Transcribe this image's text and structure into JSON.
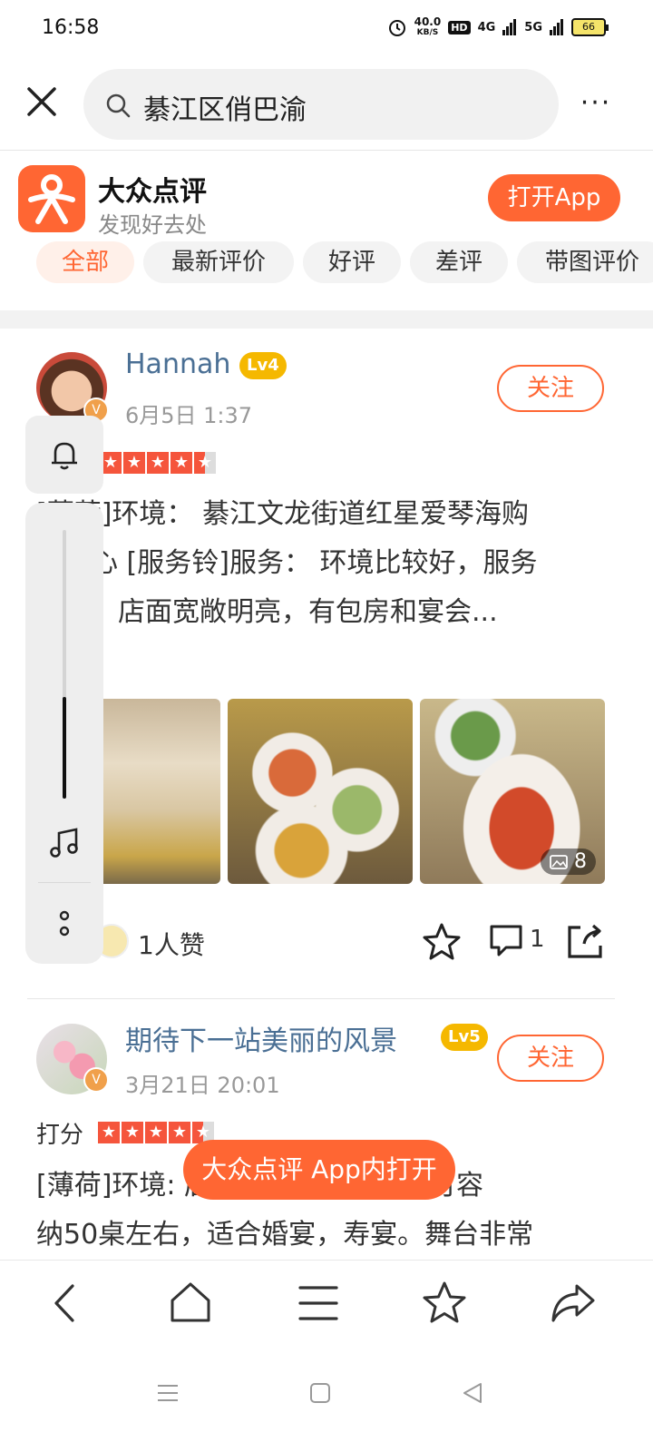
{
  "status_bar": {
    "time": "16:58",
    "network_speed": "40.0",
    "network_unit": "KB/S",
    "hd_label": "HD",
    "signal_1": "4G",
    "signal_2": "5G",
    "battery": "66"
  },
  "search": {
    "query": "綦江区俏巴渝",
    "more_label": "···"
  },
  "app_banner": {
    "name": "大众点评",
    "slogan": "发现好去处",
    "open_button": "打开App",
    "brand_color": "#ff6633"
  },
  "filter_tabs": [
    {
      "label": "全部",
      "active": true
    },
    {
      "label": "最新评价",
      "active": false
    },
    {
      "label": "好评",
      "active": false
    },
    {
      "label": "差评",
      "active": false
    },
    {
      "label": "带图评价",
      "active": false
    }
  ],
  "reviews": [
    {
      "username": "Hannah",
      "level": "Lv4",
      "date": "6月5日 1:37",
      "follow": "关注",
      "rating": 4.5,
      "text_lines": [
        "[薄荷]环境： 綦江文龙街道红星爱琴海购",
        "物中心 [服务铃]服务： 环境比较好，服务",
        "很好，店面宽敞明亮，有包房和宴会..."
      ],
      "photo_count": "8",
      "likes": "1人赞",
      "comments": "1"
    },
    {
      "username": "期待下一站美丽的风景",
      "level": "Lv5",
      "date": "3月21日 20:01",
      "follow": "关注",
      "score_label": "打分",
      "rating": 4.5,
      "text_lines": [
        "[薄荷]环境: 店面宽敞明亮，大厅可容",
        "纳50桌左右，适合婚宴，寿宴。舞台非常"
      ]
    }
  ],
  "floating_panel": {
    "volume_level": 0.38
  },
  "toast": {
    "label": "大众点评 App内打开"
  }
}
